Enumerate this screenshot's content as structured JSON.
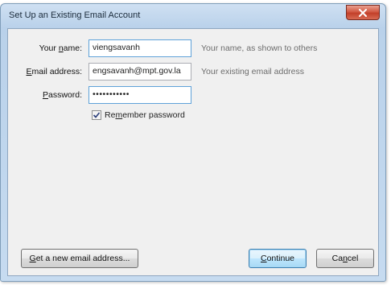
{
  "window": {
    "title": "Set Up an Existing Email Account"
  },
  "form": {
    "name": {
      "label_pre": "Your ",
      "label_key": "n",
      "label_post": "ame:",
      "value": "viengsavanh",
      "hint": "Your name, as shown to others"
    },
    "email": {
      "label_pre": "",
      "label_key": "E",
      "label_post": "mail address:",
      "value": "engsavanh@mpt.gov.la",
      "hint": "Your existing email address"
    },
    "password": {
      "label_pre": "",
      "label_key": "P",
      "label_post": "assword:",
      "value": "•••••••••••"
    },
    "remember": {
      "label_pre": "Re",
      "label_key": "m",
      "label_post": "ember password",
      "checked": true
    }
  },
  "buttons": {
    "new_email": {
      "label_pre": "",
      "label_key": "G",
      "label_post": "et a new email address..."
    },
    "continue": {
      "label_pre": "",
      "label_key": "C",
      "label_post": "ontinue"
    },
    "cancel": {
      "label_pre": "Ca",
      "label_key": "n",
      "label_post": "cel"
    }
  },
  "colors": {
    "close_button": "#c2402a",
    "default_button": "#bee6fd",
    "focus_border": "#5fa2d9"
  },
  "icons": {
    "close": "close-icon",
    "checkbox": "checkmark-icon"
  }
}
